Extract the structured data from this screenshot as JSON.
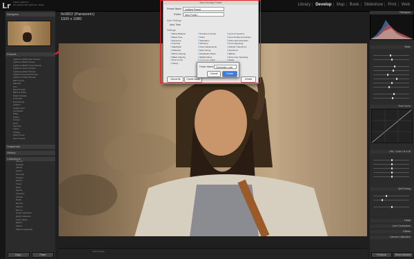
{
  "app": {
    "logo": "Lr",
    "account_line1": "Adobe Lightroom",
    "account_line2": "Get started with Lightroom mobile"
  },
  "modules": [
    {
      "label": "Library",
      "active": false
    },
    {
      "label": "Develop",
      "active": true
    },
    {
      "label": "Map",
      "active": false
    },
    {
      "label": "Book",
      "active": false
    },
    {
      "label": "Slideshow",
      "active": false
    },
    {
      "label": "Print",
      "active": false
    },
    {
      "label": "Web",
      "active": false
    }
  ],
  "photo_info": {
    "filename": "0x0822 (Panasonic)",
    "dimensions": "1920 x 1080"
  },
  "left_panel": {
    "navigator": "Navigator",
    "presets_header": "Presets",
    "presets": [
      "Lightroom B&W Filter Presets",
      "Lightroom B&W Presets",
      "Lightroom B&W Toned Presets",
      "Lightroom Color Presets",
      "Lightroom Effect Presets",
      "Lightroom General Presets",
      "Lightroom Video Presets",
      "Bolt Presets",
      "Editorial",
      "Film",
      "Basic Portrait",
      "Black & White",
      "Bright Lifestyle",
      "Cinematic",
      "Dark Moody",
      "Fashion",
      "Golden Hour",
      "Landscape",
      "Matte",
      "Nature",
      "Portrait",
      "Retro",
      "Soft Skin",
      "Travel",
      "Vintage",
      "Warm Tones",
      "User Presets"
    ],
    "snapshots": "Snapshots",
    "history": "History",
    "collections_header": "Collections",
    "collections": [
      "Albums",
      "Portfolio",
      "Clients",
      "Family",
      "Personal",
      "Projects",
      "Shoots",
      "Travel",
      "Work",
      "Events",
      "Favorites",
      "Archive",
      "Drafts",
      "Exports",
      "Selects",
      "Best of",
      "Smart Collections",
      "Quick Collection",
      "Color Labels",
      "Edited",
      "Videos",
      "Without Keywords"
    ],
    "copy_btn": "Copy...",
    "paste_btn": "Paste"
  },
  "right_panel": {
    "histogram": "Histogram",
    "basic": "Basic",
    "tone_curve": "Tone Curve",
    "hsl": "HSL / Color / B & W",
    "split_toning": "Split Toning",
    "detail": "Detail",
    "lens_corrections": "Lens Corrections",
    "effects": "Effects",
    "camera_calibration": "Camera Calibration",
    "previous_btn": "Previous",
    "reset_btn": "Reset (Adobe)"
  },
  "dialog": {
    "title": "New Develop Preset",
    "preset_name_label": "Preset Name:",
    "preset_name_value": "Untitled Preset",
    "folder_label": "Folder:",
    "folder_value": "New Folder...",
    "auto_settings_label": "Auto Settings",
    "auto_tone_label": "Auto Tone",
    "settings_label": "Settings",
    "col1": [
      "White Balance",
      "Basic Tone",
      "Exposure",
      "Contrast",
      "Highlights",
      "Shadows",
      "White Clipping",
      "Black Clipping",
      "Tone Curve",
      "Clarity"
    ],
    "col2": [
      "Treatment (Color)",
      "Color",
      "Saturation",
      "Vibrance",
      "Color Adjustments",
      "Split Toning",
      "Graduated Filters",
      "Radial Filters",
      "Noise Reduction"
    ],
    "col3": [
      "Lens Corrections",
      "Lens Profile Corrections",
      "Chromatic Aberration",
      "Lens Vignetting",
      "Upright Transforms",
      "Transform",
      "Effects",
      "Post-Crop Vignetting",
      "Grain",
      "Dehaze"
    ],
    "check_all": "Check All",
    "check_none": "Check None",
    "cancel": "Cancel",
    "create": "Create"
  },
  "sub_dialog": {
    "title": "New Folder",
    "folder_name_label": "Folder Name:",
    "folder_name_value": "Cinematic Look",
    "cancel": "Cancel",
    "create": "Create"
  },
  "filmstrip": {
    "soft_proofing": "Soft Proofing"
  },
  "colors": {
    "highlight_box": "#e02020",
    "arrow": "#e02020",
    "active_module": "#e6e6e6"
  }
}
